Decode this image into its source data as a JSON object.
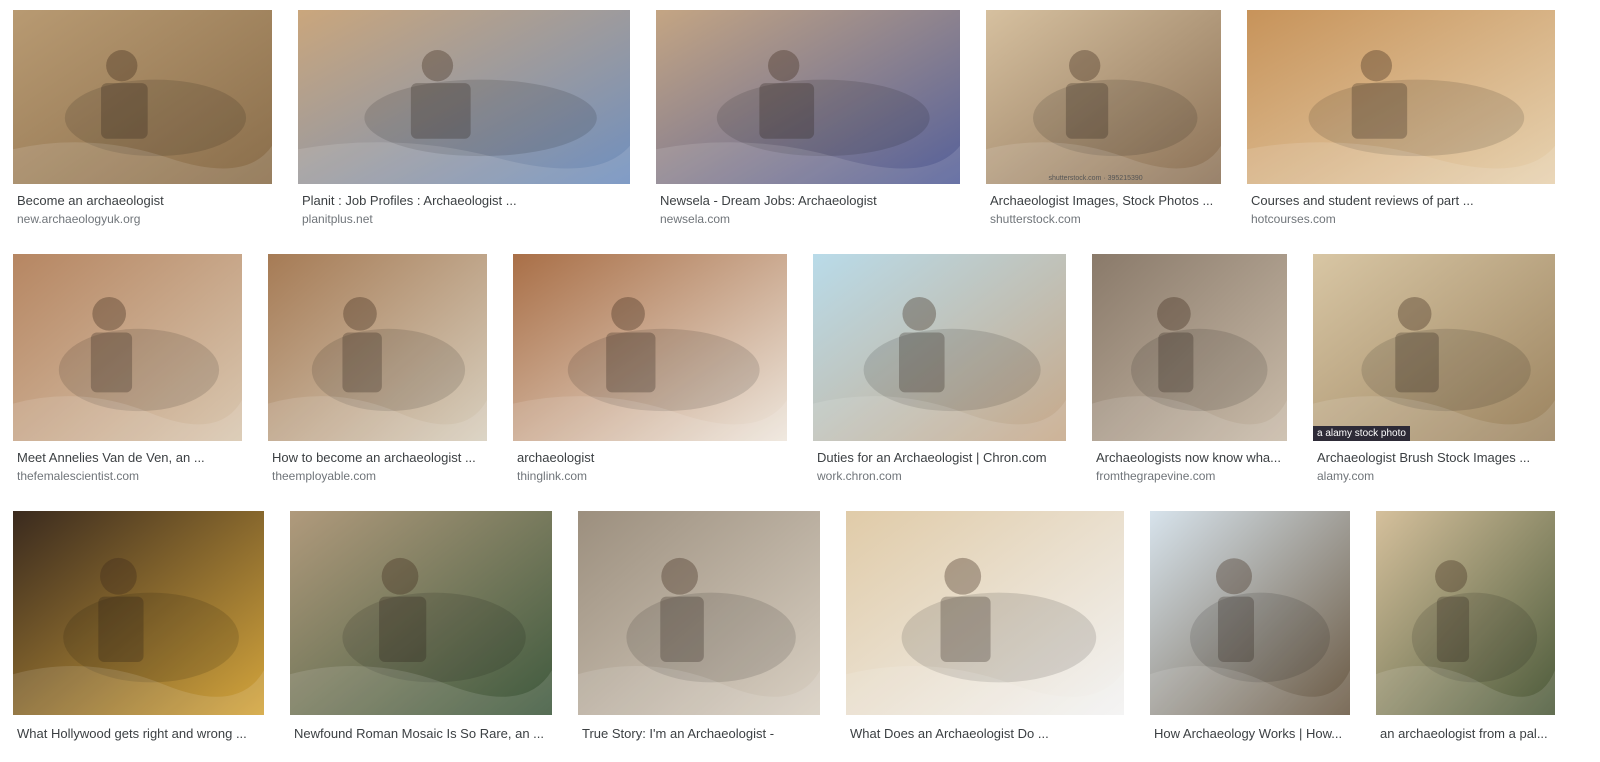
{
  "results": [
    {
      "title": "Become an archaeologist",
      "source": "new.archaeologyuk.org",
      "c1": "#b89a72",
      "c2": "#8a6e4b"
    },
    {
      "title": "Planit : Job Profiles : Archaeologist ...",
      "source": "planitplus.net",
      "c1": "#caa67c",
      "c2": "#6f8fbf"
    },
    {
      "title": "Newsela - Dream Jobs: Archaeologist",
      "source": "newsela.com",
      "c1": "#c4a583",
      "c2": "#55609a"
    },
    {
      "title": "Archaeologist Images, Stock Photos ...",
      "source": "shutterstock.com",
      "c1": "#d6c09f",
      "c2": "#8c7257",
      "watermark": "shutterstock.com · 395215390"
    },
    {
      "title": "Courses and student reviews of part ...",
      "source": "hotcourses.com",
      "c1": "#c7935a",
      "c2": "#e7d2b0"
    },
    {
      "title": "Meet Annelies Van de Ven, an ...",
      "source": "thefemalescientist.com",
      "c1": "#b68662",
      "c2": "#d9c7b0"
    },
    {
      "title": "How to become an archaeologist ...",
      "source": "theemployable.com",
      "c1": "#a67b55",
      "c2": "#d8cfbe"
    },
    {
      "title": "archaeologist",
      "source": "thinglink.com",
      "c1": "#a96f47",
      "c2": "#eee6dc"
    },
    {
      "title": "Duties for an Archaeologist | Chron.com",
      "source": "work.chron.com",
      "c1": "#b9dbe9",
      "c2": "#c7a98a"
    },
    {
      "title": "Archaeologists now know wha...",
      "source": "fromthegrapevine.com",
      "c1": "#8a7a6a",
      "c2": "#c9bba9"
    },
    {
      "title": "Archaeologist Brush Stock Images ...",
      "source": "alamy.com",
      "c1": "#d8c6a4",
      "c2": "#9c8460",
      "watermark": "a alamy stock photo"
    },
    {
      "title": "What Hollywood gets right and wrong ...",
      "source": "",
      "c1": "#3a2a1e",
      "c2": "#d4a53c"
    },
    {
      "title": "Newfound Roman Mosaic Is So Rare, an ...",
      "source": "",
      "c1": "#b09a7c",
      "c2": "#3f5a3e"
    },
    {
      "title": "True Story: I'm an Archaeologist -",
      "source": "",
      "c1": "#9c8f7e",
      "c2": "#d8cfc2"
    },
    {
      "title": "What Does an Archaeologist Do ...",
      "source": "",
      "c1": "#e0cba8",
      "c2": "#f3f3f3"
    },
    {
      "title": "How Archaeology Works | How...",
      "source": "",
      "c1": "#d7e3ec",
      "c2": "#6b5a44"
    },
    {
      "title": "an archaeologist from a pal...",
      "source": "",
      "c1": "#d5c09c",
      "c2": "#4d5b3b"
    }
  ]
}
